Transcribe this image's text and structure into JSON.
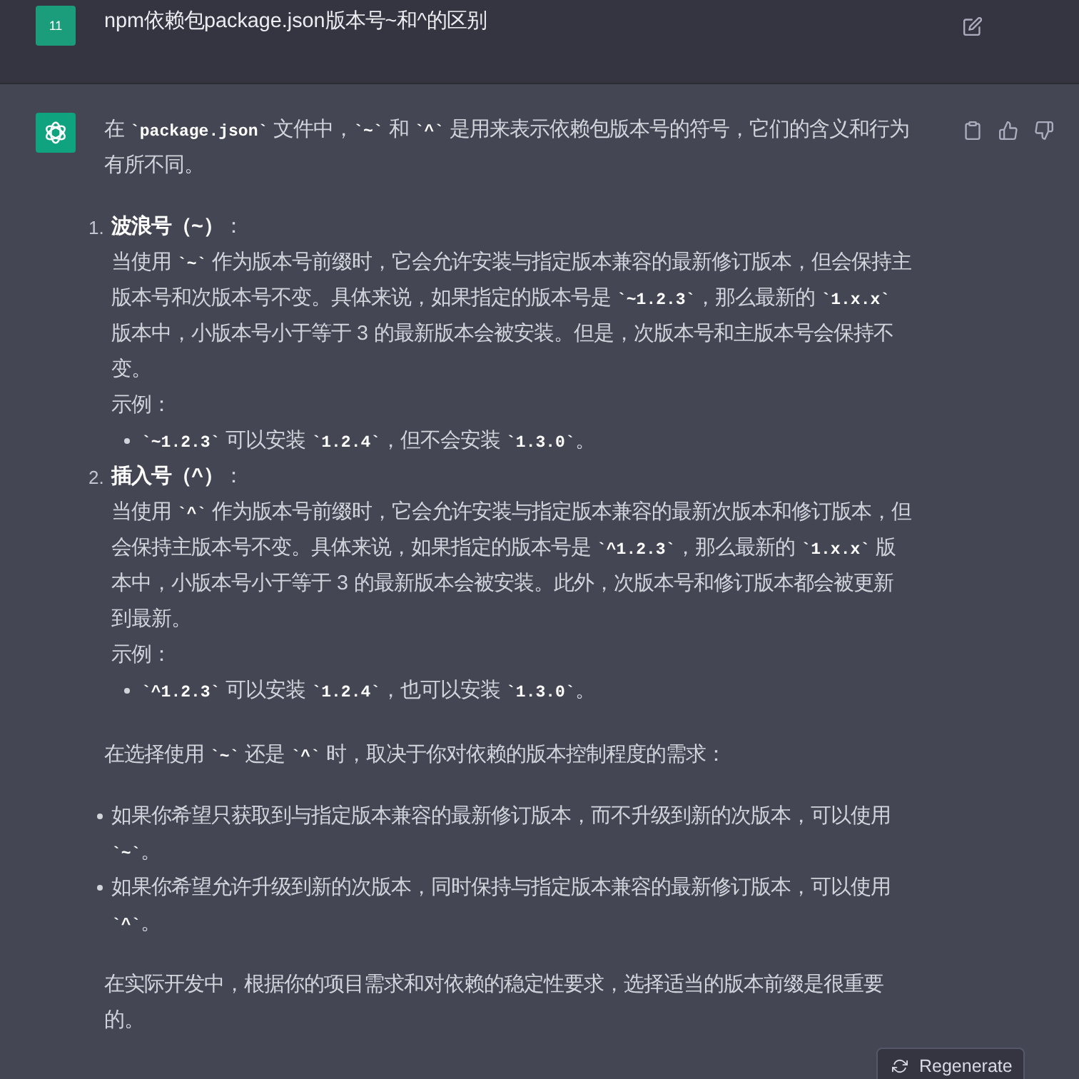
{
  "user_message": {
    "avatar_text": "11",
    "text": "npm依赖包package.json版本号~和^的区别"
  },
  "assistant_message": {
    "intro": "在 **`package.json`** 文件中，**`~`** 和 **`^`** 是用来表示依赖包版本号的符号，它们的含义和行为有所不同。",
    "numbered_list": [
      {
        "number": "1.",
        "title": "**波浪号（~）**：",
        "description": "当使用 **`~`** 作为版本号前缀时，它会允许安装与指定版本兼容的最新修订版本，但会保持主版本号和次版本号不变。具体来说，如果指定的版本号是 **`~1.2.3`**，那么最新的 **`1.x.x`** 版本中，小版本号小于等于 3 的最新版本会被安装。但是，次版本号和主版本号会保持不变。",
        "example_label": "示例：",
        "examples": [
          "**`~1.2.3`** 可以安装 **`1.2.4`**，但不会安装 **`1.3.0`**。"
        ]
      },
      {
        "number": "2.",
        "title": "**插入号（^）**：",
        "description": "当使用 **`^`** 作为版本号前缀时，它会允许安装与指定版本兼容的最新次版本和修订版本，但会保持主版本号不变。具体来说，如果指定的版本号是 **`^1.2.3`**，那么最新的 **`1.x.x`** 版本中，小版本号小于等于 3 的最新版本会被安装。此外，次版本号和修订版本都会被更新到最新。",
        "example_label": "示例：",
        "examples": [
          "**`^1.2.3`** 可以安装 **`1.2.4`**，也可以安装 **`1.3.0`**。"
        ]
      }
    ],
    "choice_intro": "在选择使用 **`~`** 还是 **`^`** 时，取决于你对依赖的版本控制程度的需求：",
    "bullets": [
      "如果你希望只获取到与指定版本兼容的最新修订版本，而不升级到新的次版本，可以使用 **`~`**。",
      "如果你希望允许升级到新的次版本，同时保持与指定版本兼容的最新修订版本，可以使用 **`^`**。"
    ],
    "conclusion": "在实际开发中，根据你的项目需求和对依赖的稳定性要求，选择适当的版本前缀是很重要的。"
  },
  "regenerate_button": {
    "label": "Regenerate"
  }
}
